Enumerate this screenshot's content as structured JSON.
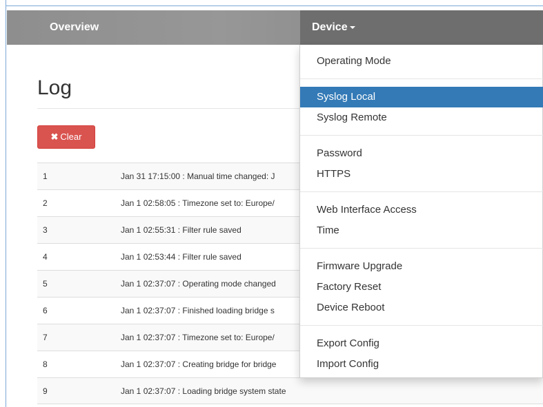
{
  "navbar": {
    "overview_label": "Overview",
    "device_label": "Device"
  },
  "page": {
    "title": "Log",
    "clear_icon": "✖",
    "clear_label": "Clear"
  },
  "log": [
    {
      "num": "1",
      "message": "Jan 31 17:15:00 : Manual time changed: J"
    },
    {
      "num": "2",
      "message": "Jan 1 02:58:05 : Timezone set to: Europe/"
    },
    {
      "num": "3",
      "message": "Jan 1 02:55:31 : Filter rule saved"
    },
    {
      "num": "4",
      "message": "Jan 1 02:53:44 : Filter rule saved"
    },
    {
      "num": "5",
      "message": "Jan 1 02:37:07 : Operating mode changed"
    },
    {
      "num": "6",
      "message": "Jan 1 02:37:07 : Finished loading bridge s"
    },
    {
      "num": "7",
      "message": "Jan 1 02:37:07 : Timezone set to: Europe/"
    },
    {
      "num": "8",
      "message": "Jan 1 02:37:07 : Creating bridge for bridge"
    },
    {
      "num": "9",
      "message": "Jan 1 02:37:07 : Loading bridge system state"
    }
  ],
  "dropdown": {
    "items": [
      "Operating Mode",
      "Syslog Local",
      "Syslog Remote",
      "Password",
      "HTTPS",
      "Web Interface Access",
      "Time",
      "Firmware Upgrade",
      "Factory Reset",
      "Device Reboot",
      "Export Config",
      "Import Config"
    ],
    "active_item": "Syslog Local"
  },
  "colors": {
    "navbar": "#8e8e8e",
    "navbar_active": "#6e6e6e",
    "danger": "#d9534f",
    "selection": "#337ab7"
  }
}
